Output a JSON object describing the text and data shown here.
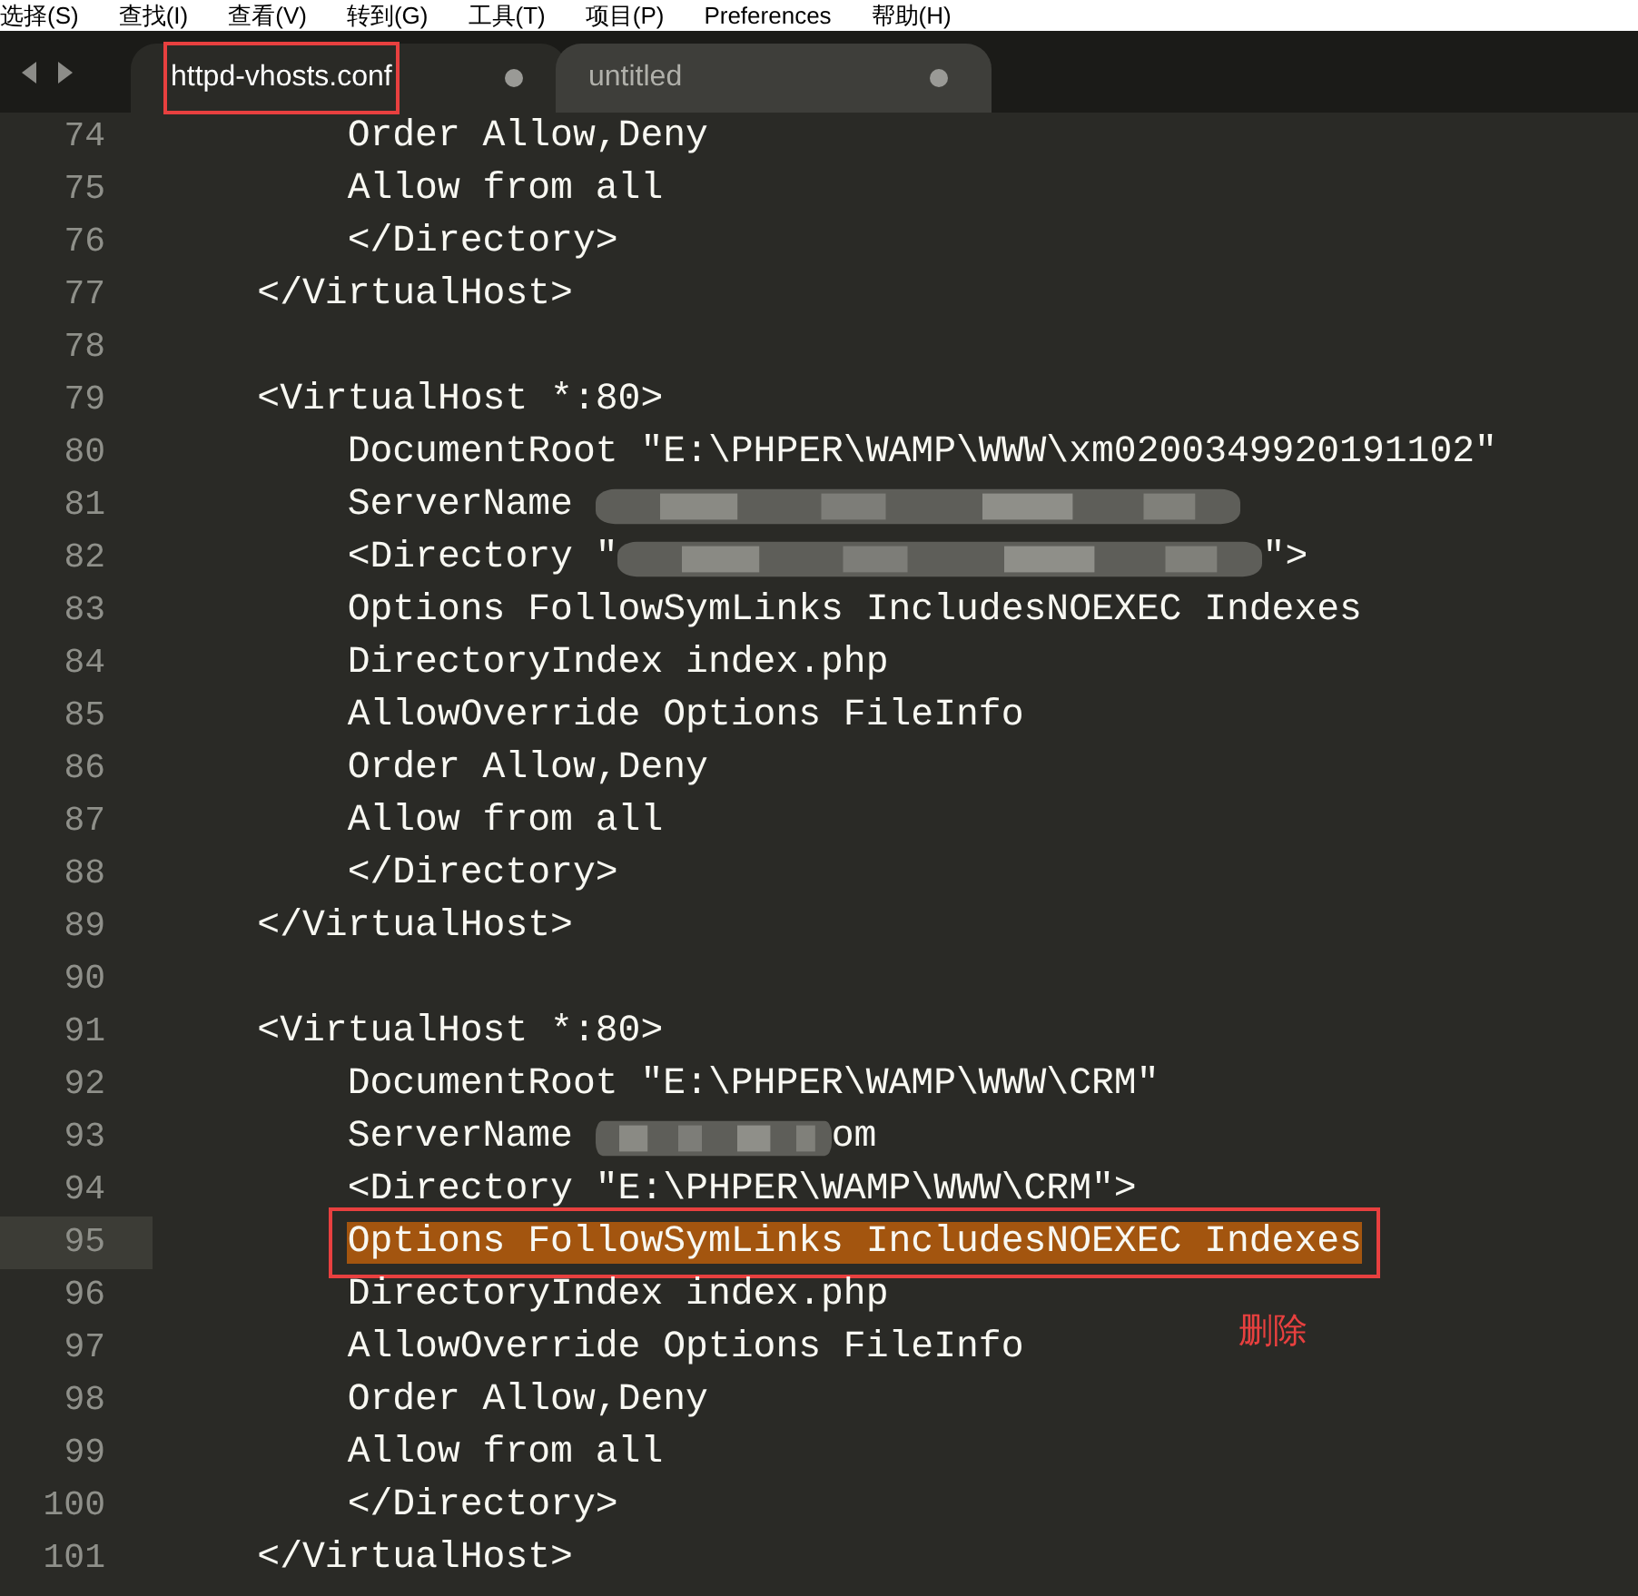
{
  "menu": [
    "选择(S)",
    "查找(I)",
    "查看(V)",
    "转到(G)",
    "工具(T)",
    "项目(P)",
    "Preferences",
    "帮助(H)"
  ],
  "tabs": [
    {
      "label": "httpd-vhosts.conf",
      "selected": true,
      "dirty": true,
      "boxed": true
    },
    {
      "label": "untitled",
      "selected": false,
      "dirty": true,
      "boxed": false
    }
  ],
  "lines": [
    {
      "number": "74",
      "selected": false,
      "boxed": false,
      "segments": [
        {
          "kind": "text",
          "text": "        Order Allow,Deny"
        }
      ]
    },
    {
      "number": "75",
      "selected": false,
      "boxed": false,
      "segments": [
        {
          "kind": "text",
          "text": "        Allow from all"
        }
      ]
    },
    {
      "number": "76",
      "selected": false,
      "boxed": false,
      "segments": [
        {
          "kind": "text",
          "text": "        </Directory>"
        }
      ]
    },
    {
      "number": "77",
      "selected": false,
      "boxed": false,
      "segments": [
        {
          "kind": "text",
          "text": "    </VirtualHost>"
        }
      ]
    },
    {
      "number": "78",
      "selected": false,
      "boxed": false
    },
    {
      "number": "79",
      "selected": false,
      "boxed": false,
      "segments": [
        {
          "kind": "text",
          "text": "    <VirtualHost *:80>"
        }
      ]
    },
    {
      "number": "80",
      "selected": false,
      "boxed": false,
      "segments": [
        {
          "kind": "text",
          "text": "        DocumentRoot \"E:\\PHPER\\WAMP\\WWW\\xm0200349920191102\""
        }
      ]
    },
    {
      "number": "81",
      "selected": false,
      "boxed": false,
      "segments": [
        {
          "kind": "text",
          "text": "        ServerName "
        },
        {
          "kind": "blur"
        }
      ]
    },
    {
      "number": "82",
      "selected": false,
      "boxed": false,
      "segments": [
        {
          "kind": "text",
          "text": "        <Directory \""
        },
        {
          "kind": "blur"
        },
        {
          "kind": "text",
          "text": "\">"
        }
      ]
    },
    {
      "number": "83",
      "selected": false,
      "boxed": false,
      "segments": [
        {
          "kind": "text",
          "text": "        Options FollowSymLinks IncludesNOEXEC Indexes"
        }
      ]
    },
    {
      "number": "84",
      "selected": false,
      "boxed": false,
      "segments": [
        {
          "kind": "text",
          "text": "        DirectoryIndex index.php"
        }
      ]
    },
    {
      "number": "85",
      "selected": false,
      "boxed": false,
      "segments": [
        {
          "kind": "text",
          "text": "        AllowOverride Options FileInfo"
        }
      ]
    },
    {
      "number": "86",
      "selected": false,
      "boxed": false,
      "segments": [
        {
          "kind": "text",
          "text": "        Order Allow,Deny"
        }
      ]
    },
    {
      "number": "87",
      "selected": false,
      "boxed": false,
      "segments": [
        {
          "kind": "text",
          "text": "        Allow from all"
        }
      ]
    },
    {
      "number": "88",
      "selected": false,
      "boxed": false,
      "segments": [
        {
          "kind": "text",
          "text": "        </Directory>"
        }
      ]
    },
    {
      "number": "89",
      "selected": false,
      "boxed": false,
      "segments": [
        {
          "kind": "text",
          "text": "    </VirtualHost>"
        }
      ]
    },
    {
      "number": "90",
      "selected": false,
      "boxed": false
    },
    {
      "number": "91",
      "selected": false,
      "boxed": false,
      "segments": [
        {
          "kind": "text",
          "text": "    <VirtualHost *:80>"
        }
      ]
    },
    {
      "number": "92",
      "selected": false,
      "boxed": false,
      "segments": [
        {
          "kind": "text",
          "text": "        DocumentRoot \"E:\\PHPER\\WAMP\\WWW\\CRM\""
        }
      ]
    },
    {
      "number": "93",
      "selected": false,
      "boxed": false,
      "segments": [
        {
          "kind": "text",
          "text": "        ServerName "
        },
        {
          "kind": "smudge"
        },
        {
          "kind": "text",
          "text": "om"
        }
      ]
    },
    {
      "number": "94",
      "selected": false,
      "boxed": false,
      "segments": [
        {
          "kind": "text",
          "text": "        <Directory \"E:\\PHPER\\WAMP\\WWW\\CRM\">"
        }
      ]
    },
    {
      "number": "95",
      "selected": true,
      "boxed": true,
      "segments": [
        {
          "kind": "indent"
        },
        {
          "kind": "text",
          "text": "Options FollowSymLinks IncludesNOEXEC Indexes"
        }
      ]
    },
    {
      "number": "96",
      "selected": false,
      "boxed": false,
      "segments": [
        {
          "kind": "text",
          "text": "        DirectoryIndex index.php"
        }
      ]
    },
    {
      "number": "97",
      "selected": false,
      "boxed": false,
      "segments": [
        {
          "kind": "text",
          "text": "        AllowOverride Options FileInfo"
        }
      ],
      "note": "删除"
    },
    {
      "number": "98",
      "selected": false,
      "boxed": false,
      "segments": [
        {
          "kind": "text",
          "text": "        Order Allow,Deny"
        }
      ]
    },
    {
      "number": "99",
      "selected": false,
      "boxed": false,
      "segments": [
        {
          "kind": "text",
          "text": "        Allow from all"
        }
      ]
    },
    {
      "number": "100",
      "selected": false,
      "boxed": false,
      "segments": [
        {
          "kind": "text",
          "text": "        </Directory>"
        }
      ]
    },
    {
      "number": "101",
      "selected": false,
      "boxed": false,
      "segments": [
        {
          "kind": "text",
          "text": "    </VirtualHost>"
        }
      ]
    }
  ]
}
